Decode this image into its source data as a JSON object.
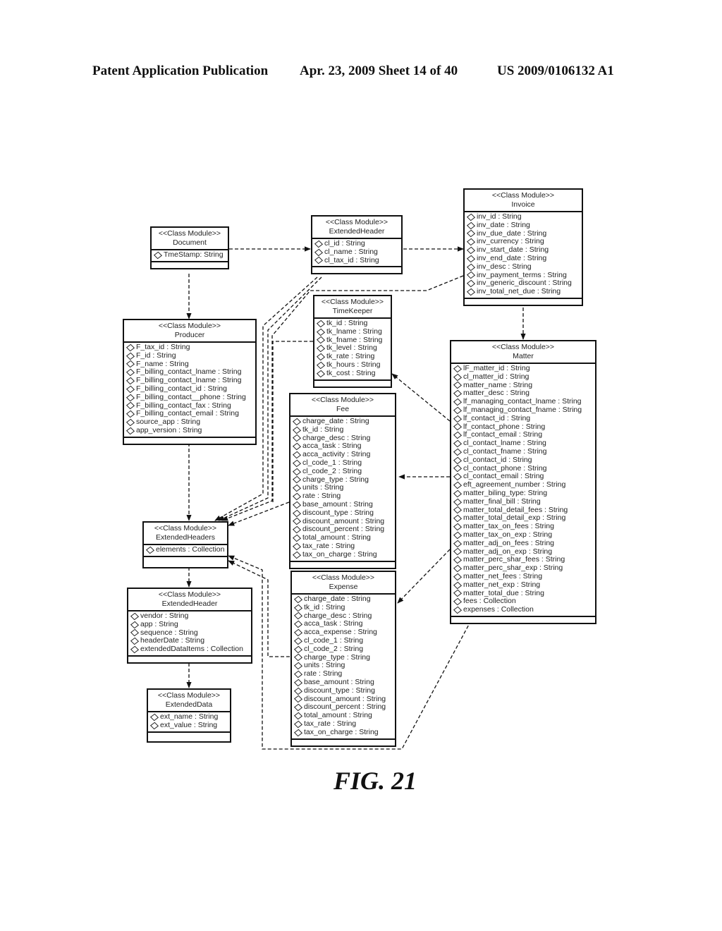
{
  "header": {
    "left": "Patent Application Publication",
    "middle": "Apr. 23, 2009  Sheet 14 of 40",
    "right": "US 2009/0106132 A1"
  },
  "figure_label": "FIG. 21",
  "stereotype": "<<Class Module>>",
  "classes": {
    "document": {
      "name": "Document",
      "attributes": [
        "TmeStamp: String"
      ]
    },
    "extended_header_top": {
      "name": "ExtendedHeader",
      "attributes": [
        "cl_id : String",
        "cl_name : String",
        "cl_tax_id : String"
      ]
    },
    "invoice": {
      "name": "Invoice",
      "attributes": [
        "inv_id : String",
        "inv_date : String",
        "inv_due_date : String",
        "inv_currency : String",
        "inv_start_date : String",
        "inv_end_date : String",
        "inv_desc : String",
        "inv_payment_terms : String",
        "inv_generic_discount : String",
        "inv_total_net_due : String"
      ]
    },
    "producer": {
      "name": "Producer",
      "attributes": [
        "F_tax_id : String",
        "F_id : String",
        "F_name : String",
        "F_billing_contact_lname : String",
        "F_billing_contact_lname : String",
        "F_billing_contact_id : String",
        "F_billing_contact__phone : String",
        "F_billing_contact_fax : String",
        "F_billing_contact_email : String",
        "source_app : String",
        "app_version : String"
      ]
    },
    "timekeeper": {
      "name": "TimeKeeper",
      "attributes": [
        "tk_id : String",
        "tk_lname : String",
        "tk_fname : String",
        "tk_level : String",
        "tk_rate : String",
        "tk_hours : String",
        "tk_cost : String"
      ]
    },
    "fee": {
      "name": "Fee",
      "attributes": [
        "charge_date : String",
        "tk_id : String",
        "charge_desc : String",
        "acca_task : String",
        "acca_activity : String",
        "cl_code_1 : String",
        "cl_code_2 : String",
        "charge_type : String",
        "units : String",
        "rate : String",
        "base_amount : String",
        "discount_type : String",
        "discount_amount : String",
        "discount_percent : String",
        "total_amount : String",
        "tax_rate : String",
        "tax_on_charge : String"
      ]
    },
    "matter": {
      "name": "Matter",
      "attributes": [
        "lF_matter_id : String",
        "cl_matter_id : String",
        "matter_name : String",
        "matter_desc : String",
        "lf_managing_contact_lname : String",
        "lf_managing_contact_fname : String",
        "lf_contact_id : String",
        "lf_contact_phone : String",
        "lf_contact_email : String",
        "cl_contact_lname : String",
        "cl_contact_fname : String",
        "cl_contact_id : String",
        "cl_contact_phone : String",
        "cl_contact_email : String",
        "eft_agreement_number : String",
        "matter_biling_type: String",
        "matter_final_bill : String",
        "matter_total_detail_fees : String",
        "matter_total_detail_exp : String",
        "matter_tax_on_fees : String",
        "matter_tax_on_exp : String",
        "matter_adj_on_fees : String",
        "matter_adj_on_exp : String",
        "matter_perc_shar_fees : String",
        "matter_perc_shar_exp : String",
        "matter_net_fees : String",
        "matter_net_exp : String",
        "matter_total_due : String",
        "fees : Collection",
        "expenses : Collection"
      ]
    },
    "extended_headers": {
      "name": "ExtendedHeaders",
      "attributes": [
        "elements : Collection"
      ]
    },
    "expense": {
      "name": "Expense",
      "attributes": [
        "charge_date : String",
        "tk_id : String",
        "charge_desc : String",
        "acca_task : String",
        "acca_expense : String",
        "cl_code_1 : String",
        "cl_code_2 : String",
        "charge_type : String",
        "units : String",
        "rate : String",
        "base_amount : String",
        "discount_type : String",
        "discount_amount : String",
        "discount_percent : String",
        "total_amount : String",
        "tax_rate : String",
        "tax_on_charge : String"
      ]
    },
    "extended_header_bottom": {
      "name": "ExtendedHeader",
      "attributes": [
        "vendor : String",
        "app : String",
        "sequence : String",
        "headerDate : String",
        "extendedDataItems : Collection"
      ]
    },
    "extended_data": {
      "name": "ExtendedData",
      "attributes": [
        "ext_name : String",
        "ext_value : String"
      ]
    }
  }
}
